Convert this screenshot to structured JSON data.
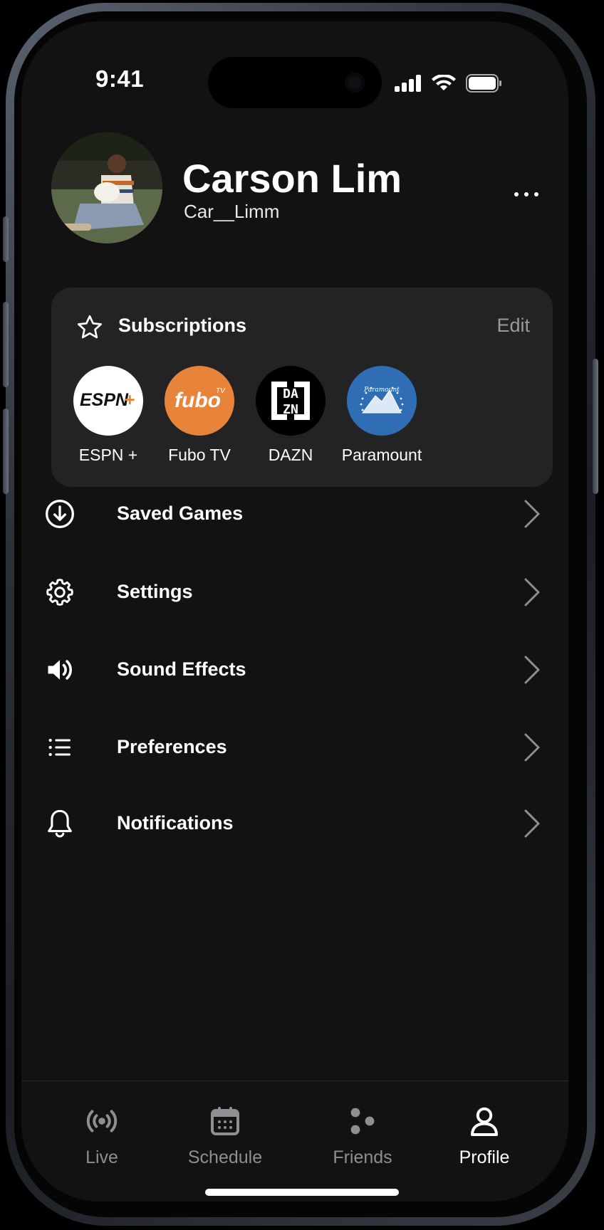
{
  "status": {
    "time": "9:41"
  },
  "profile": {
    "name": "Carson Lim",
    "handle": "Car__Limm"
  },
  "subscriptions": {
    "title": "Subscriptions",
    "edit_label": "Edit",
    "items": [
      {
        "label": "ESPN +",
        "logo_text": "ESPN",
        "bg": "#ffffff"
      },
      {
        "label": "Fubo TV",
        "logo_text": "fubo",
        "logo_sup": "TV",
        "bg": "#e8843a"
      },
      {
        "label": "DAZN",
        "logo_text": "DAZN",
        "bg": "#000000"
      },
      {
        "label": "Paramount",
        "logo_text": "Paramount",
        "bg": "#2f6db5"
      }
    ]
  },
  "menu": [
    {
      "label": "Saved Games",
      "icon": "download-circle-icon"
    },
    {
      "label": "Settings",
      "icon": "gear-icon"
    },
    {
      "label": "Sound Effects",
      "icon": "speaker-icon"
    },
    {
      "label": "Preferences",
      "icon": "list-icon"
    },
    {
      "label": "Notifications",
      "icon": "bell-icon"
    }
  ],
  "tabs": [
    {
      "label": "Live",
      "icon": "broadcast-icon",
      "active": false
    },
    {
      "label": "Schedule",
      "icon": "calendar-icon",
      "active": false
    },
    {
      "label": "Friends",
      "icon": "friends-icon",
      "active": false
    },
    {
      "label": "Profile",
      "icon": "person-icon",
      "active": true
    }
  ],
  "colors": {
    "background": "#121212",
    "card": "#232325",
    "inactive_tab": "#8e8e93",
    "active_tab": "#ffffff"
  }
}
